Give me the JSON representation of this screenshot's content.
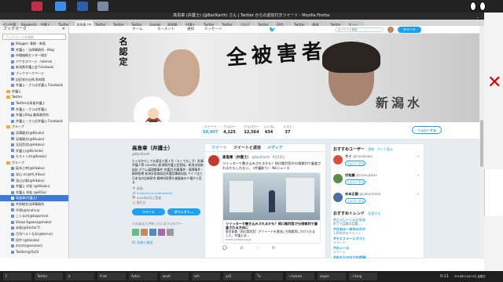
{
  "browser": {
    "title": "高島章 (弁護士) (@BarlKarth) さん | Twitter からの返信付きツイート - Mozilla Firefox",
    "window_controls": "_ □ ×",
    "url": "https://twitter.com/BarlKarth/with_replies",
    "tabs": [
      "ゼロ弁護",
      "Bloggerの",
      "弁護士",
      "Twitter",
      "高島章 (弁",
      "Twitter",
      "Twitter",
      "Twitter",
      "Google",
      "高島章",
      "弁護士",
      "Twitter",
      "Twitter",
      "ブログ",
      "Twitter",
      "(返信",
      "Twitter",
      "報道",
      "Twitter",
      "ネット"
    ]
  },
  "sidebar": {
    "title": "ブックマーク",
    "close": "×",
    "search_placeholder": "ブックマークを検索",
    "items": [
      {
        "label": "Blogger: 青柳・新島",
        "type": "bm"
      },
      {
        "label": "弁護士・法律事務所 - Blog",
        "type": "bm"
      },
      {
        "label": "市場価格センター統計",
        "type": "bm"
      },
      {
        "label": "アクセスページ - Intenso",
        "type": "bm"
      },
      {
        "label": "新潟県弁護士会 Facebook",
        "type": "bm"
      },
      {
        "label": "ブックマークページ",
        "type": "bm"
      },
      {
        "label": "自民党の出馬 取材版",
        "type": "bm"
      },
      {
        "label": "弁護士・さらば弁護士 Facebook",
        "type": "bm"
      },
      {
        "label": "弁護士",
        "type": "folder"
      },
      {
        "label": "Twitter",
        "type": "folder"
      },
      {
        "label": "Twitterの高島弁護士",
        "type": "bm"
      },
      {
        "label": "弁護士・さらば弁護士",
        "type": "bm"
      },
      {
        "label": "弁護士Blog 最高裁判所",
        "type": "bm"
      },
      {
        "label": "弁護士・さらば弁護士 Facebook",
        "type": "bm"
      },
      {
        "label": "グループ",
        "type": "folder"
      },
      {
        "label": "深澤論文(@Kikuko)",
        "type": "bm"
      },
      {
        "label": "深澤論文(@Kikuko)",
        "type": "bm"
      },
      {
        "label": "太田哲也(@Hikaku)",
        "type": "bm"
      },
      {
        "label": "弁護士(@Kiklinda)",
        "type": "bm"
      },
      {
        "label": "モストンの(@Kazuk)",
        "type": "bm"
      },
      {
        "label": "グループ",
        "type": "folder"
      },
      {
        "label": "坂本江幸(@Hikaku)",
        "type": "bm"
      },
      {
        "label": "深山 沙(@Hi_Kikuo)",
        "type": "bm"
      },
      {
        "label": "深山沙耶(@Hikaku)",
        "type": "bm"
      },
      {
        "label": "弁護士 村松 (@Hikaku)",
        "type": "bm"
      },
      {
        "label": "弁護士 村松 (@HiSa)",
        "type": "bm"
      },
      {
        "label": "高島章(弁護士)",
        "type": "bm",
        "selected": true
      },
      {
        "label": "共栄総合法律事務所",
        "type": "bm"
      },
      {
        "label": "平明(@hirahira)",
        "type": "bm"
      },
      {
        "label": "こぐまの(@kogumao)",
        "type": "bm"
      },
      {
        "label": "Shoko Egawa(@shoko)",
        "type": "bm"
      },
      {
        "label": "赤坂(@DoctorT)",
        "type": "bm"
      },
      {
        "label": "月刊ベルトなお(@berun)",
        "type": "bm"
      },
      {
        "label": "田中 (@tanaka)",
        "type": "bm"
      },
      {
        "label": "ののの(@ononon)",
        "type": "bm"
      },
      {
        "label": "Twitter(@OoO)",
        "type": "bm"
      }
    ]
  },
  "twitter": {
    "nav": {
      "home": "ホーム",
      "moments": "モーメント",
      "notifications": "通知",
      "messages": "メッセージ",
      "search_placeholder": "キーワード検索",
      "tweet": "ツイート"
    },
    "banner_text": {
      "line1": "名認定",
      "line2": "全被害者",
      "line3": "新潟水"
    },
    "stats": [
      {
        "label": "ツイート",
        "value": "59,407"
      },
      {
        "label": "フォロー",
        "value": "4,125"
      },
      {
        "label": "フォロワー",
        "value": "12,564"
      },
      {
        "label": "いいね",
        "value": "434"
      },
      {
        "label": "リスト",
        "value": "37"
      }
    ],
    "follow_button": "フォローする",
    "profile": {
      "name": "高島章（弁護士）",
      "handle": "@BarlKarth",
      "bio": "たぐのかもしでの意見で第１号（ろくでなし子）刑事弁護人等 2000年に新潟県弁護士会登録。新潟水俣病訴訟 オウム真理教事件 弁護団 刑事事件・冤罪事件・精神医療 新潟水俣病訴訟弁護団事務局長 ドイツ法と日本法の比較研究 精神科医療を被疑者の人権から見る",
      "location": "新潟",
      "url": "it.twitter.ne.jp/BarlKarth",
      "joined": "2009年8月に登録",
      "birthday": "誕生日",
      "btn_tweet": "ツイート",
      "btn_dm": "ダイレクト...",
      "followers_you_know": "人のあなたが知っているフォロワー",
      "lists": "81 画像と動画"
    },
    "timeline": {
      "tabs": [
        "ツイート",
        "ツイートと返信",
        "メディア"
      ],
      "tweet": {
        "name": "高島章（弁護士）",
        "handle": "@BarlKarth · 9月19日",
        "text": "ツイッターで書き込みされるかも？岡口裁判官の分限裁判で審査されるかもしれない。 (弁護取り) - NEニュース",
        "card_title": "ツイッターで書き込みされるかも？岡口裁判官が分限裁判で審査される方向に",
        "card_desc": "東京高裁（岡口裁判官）がツイートを理由に分限裁判にかけられました。弁護士は...",
        "card_url": "news.yahoo.co.jp",
        "actions": [
          "💬",
          "⇄",
          "♡",
          "✉"
        ]
      }
    },
    "who_to_follow": {
      "title": "おすすめユーザー",
      "refresh": "· 更新 · すべて見る",
      "users": [
        {
          "name": "サイ",
          "handle": "@hosokawa",
          "btn": "フォローする",
          "color": "#d94f3d"
        },
        {
          "name": "村松謙",
          "handle": "@masujokan",
          "btn": "フォローする",
          "color": "#5a8f4a"
        },
        {
          "name": "末本正樹",
          "handle": "@sakamotoe",
          "btn": "フォローする",
          "color": "#4a6fa5"
        }
      ]
    },
    "trends": {
      "title": "おすすめトレンド",
      "change": "· 変更する",
      "items": [
        {
          "tag": "#こっしーこんにちは",
          "desc": "BTTで話題の話題..."
        },
        {
          "tag": "#日本は一体何なのか",
          "desc": "1,000件のツイート"
        },
        {
          "tag": "#モエスメールポスト",
          "desc": "ツイート"
        },
        {
          "tag": "#おふーる",
          "desc": "ツイート"
        },
        {
          "tag": "#あなたの全力の笑顔",
          "desc": ""
        }
      ]
    }
  },
  "taskbar": {
    "items": [
      "F",
      "Twitter",
      "a",
      "Fnet",
      "Ashvi",
      "work",
      "ssh",
      "xa5",
      "Tx",
      "~/xclock",
      "xeyes",
      "~/Ling"
    ],
    "clock": "0:11",
    "date": "2018年10月19日 金曜日"
  },
  "colors": {
    "twitter_blue": "#1da1f2",
    "desktop_bg": "#222222",
    "selected_bookmark": "#3d7bd9"
  }
}
